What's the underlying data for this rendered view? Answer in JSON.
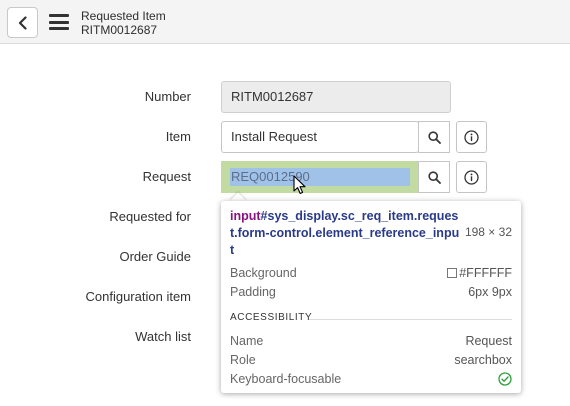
{
  "header": {
    "title": "Requested Item",
    "subtitle": "RITM0012687"
  },
  "form": {
    "labels": {
      "number": "Number",
      "item": "Item",
      "request": "Request",
      "requested_for": "Requested for",
      "order_guide": "Order Guide",
      "configuration_item": "Configuration item",
      "watch_list": "Watch list"
    },
    "number_value": "RITM0012687",
    "item_value": "Install Request",
    "request_value": "REQ0012590"
  },
  "inspector": {
    "selector_tag": "input",
    "selector_rest": "#sys_display.sc_req_item.request.form-control.element_reference_input",
    "dimensions": "198 × 32",
    "background_label": "Background",
    "background_value": "#FFFFFF",
    "padding_label": "Padding",
    "padding_value": "6px 9px",
    "accessibility_heading": "ACCESSIBILITY",
    "name_label": "Name",
    "name_value": "Request",
    "role_label": "Role",
    "role_value": "searchbox",
    "keyboard_label": "Keyboard-focusable",
    "keyboard_icon": "check-circle-icon"
  },
  "colors": {
    "highlight_margin": "#c2dba3",
    "highlight_content": "#a1c2e8",
    "selector_tag": "#881280",
    "selector_text": "#2a3a8a",
    "check": "#2e9e3b"
  }
}
